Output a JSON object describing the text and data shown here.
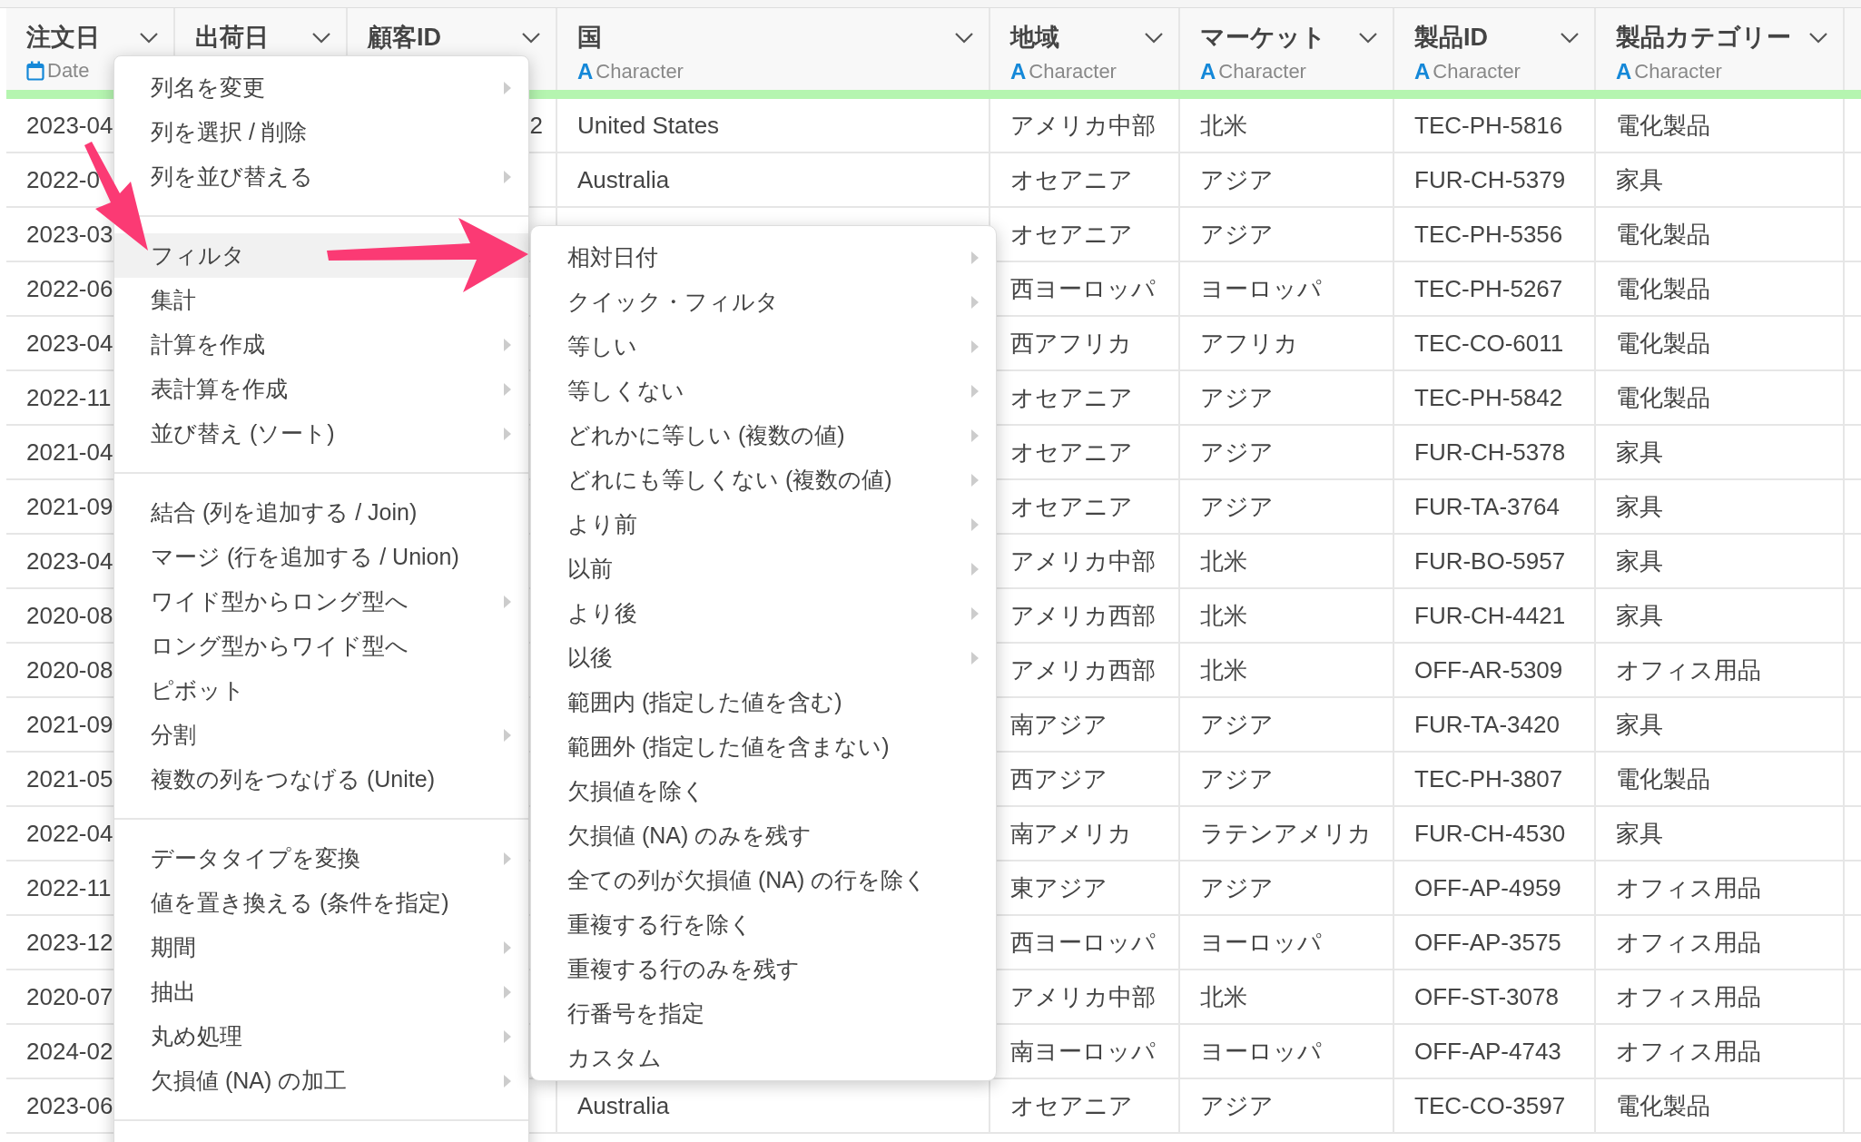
{
  "table": {
    "columns": [
      {
        "name": "注文日",
        "type": {
          "kind": "date",
          "label": "Date"
        }
      },
      {
        "name": "出荷日"
      },
      {
        "name": "顧客ID"
      },
      {
        "name": "国",
        "type": {
          "kind": "character",
          "glyph": "A",
          "label": "Character"
        }
      },
      {
        "name": "地域",
        "type": {
          "kind": "character",
          "glyph": "A",
          "label": "Character"
        }
      },
      {
        "name": "マーケット",
        "type": {
          "kind": "character",
          "glyph": "A",
          "label": "Character"
        }
      },
      {
        "name": "製品ID",
        "type": {
          "kind": "character",
          "glyph": "A",
          "label": "Character"
        }
      },
      {
        "name": "製品カテゴリー",
        "type": {
          "kind": "character",
          "glyph": "A",
          "label": "Character"
        }
      }
    ],
    "rows": [
      {
        "cells": [
          "2023-04",
          null,
          "2",
          "United States",
          "アメリカ中部",
          "北米",
          "TEC-PH-5816",
          "電化製品"
        ]
      },
      {
        "cells": [
          "2022-0",
          null,
          null,
          "Australia",
          "オセアニア",
          "アジア",
          "FUR-CH-5379",
          "家具"
        ]
      },
      {
        "cells": [
          "2023-03",
          null,
          null,
          null,
          "オセアニア",
          "アジア",
          "TEC-PH-5356",
          "電化製品"
        ]
      },
      {
        "cells": [
          "2022-06",
          null,
          null,
          null,
          "西ヨーロッパ",
          "ヨーロッパ",
          "TEC-PH-5267",
          "電化製品"
        ]
      },
      {
        "cells": [
          "2023-04",
          null,
          null,
          null,
          "西アフリカ",
          "アフリカ",
          "TEC-CO-6011",
          "電化製品"
        ]
      },
      {
        "cells": [
          "2022-11",
          null,
          null,
          null,
          "オセアニア",
          "アジア",
          "TEC-PH-5842",
          "電化製品"
        ]
      },
      {
        "cells": [
          "2021-04",
          null,
          null,
          null,
          "オセアニア",
          "アジア",
          "FUR-CH-5378",
          "家具"
        ]
      },
      {
        "cells": [
          "2021-09",
          null,
          null,
          null,
          "オセアニア",
          "アジア",
          "FUR-TA-3764",
          "家具"
        ]
      },
      {
        "cells": [
          "2023-04",
          null,
          null,
          null,
          "アメリカ中部",
          "北米",
          "FUR-BO-5957",
          "家具"
        ]
      },
      {
        "cells": [
          "2020-08",
          null,
          null,
          null,
          "アメリカ西部",
          "北米",
          "FUR-CH-4421",
          "家具"
        ]
      },
      {
        "cells": [
          "2020-08",
          null,
          null,
          null,
          "アメリカ西部",
          "北米",
          "OFF-AR-5309",
          "オフィス用品"
        ]
      },
      {
        "cells": [
          "2021-09",
          null,
          null,
          null,
          "南アジア",
          "アジア",
          "FUR-TA-3420",
          "家具"
        ]
      },
      {
        "cells": [
          "2021-05",
          null,
          null,
          null,
          "西アジア",
          "アジア",
          "TEC-PH-3807",
          "電化製品"
        ]
      },
      {
        "cells": [
          "2022-04",
          null,
          null,
          null,
          "南アメリカ",
          "ラテンアメリカ",
          "FUR-CH-4530",
          "家具"
        ]
      },
      {
        "cells": [
          "2022-11",
          null,
          null,
          null,
          "東アジア",
          "アジア",
          "OFF-AP-4959",
          "オフィス用品"
        ]
      },
      {
        "cells": [
          "2023-12",
          null,
          null,
          null,
          "西ヨーロッパ",
          "ヨーロッパ",
          "OFF-AP-3575",
          "オフィス用品"
        ]
      },
      {
        "cells": [
          "2020-07",
          null,
          null,
          null,
          "アメリカ中部",
          "北米",
          "OFF-ST-3078",
          "オフィス用品"
        ]
      },
      {
        "cells": [
          "2024-02",
          null,
          null,
          null,
          "南ヨーロッパ",
          "ヨーロッパ",
          "OFF-AP-4743",
          "オフィス用品"
        ]
      },
      {
        "cells": [
          "2023-06",
          null,
          null,
          "Australia",
          "オセアニア",
          "アジア",
          "TEC-CO-3597",
          "電化製品"
        ]
      }
    ]
  },
  "column_menu": {
    "sections": [
      [
        {
          "label": "列名を変更",
          "has_submenu": true,
          "selected": false
        },
        {
          "label": "列を選択 / 削除",
          "has_submenu": false,
          "selected": false
        },
        {
          "label": "列を並び替える",
          "has_submenu": true,
          "selected": false
        }
      ],
      [
        {
          "label": "フィルタ",
          "has_submenu": false,
          "selected": true
        },
        {
          "label": "集計",
          "has_submenu": false,
          "selected": false
        },
        {
          "label": "計算を作成",
          "has_submenu": true,
          "selected": false
        },
        {
          "label": "表計算を作成",
          "has_submenu": true,
          "selected": false
        },
        {
          "label": "並び替え (ソート)",
          "has_submenu": true,
          "selected": false
        }
      ],
      [
        {
          "label": "結合 (列を追加する / Join)",
          "has_submenu": false,
          "selected": false
        },
        {
          "label": "マージ (行を追加する / Union)",
          "has_submenu": false,
          "selected": false
        },
        {
          "label": "ワイド型からロング型へ",
          "has_submenu": true,
          "selected": false
        },
        {
          "label": "ロング型からワイド型へ",
          "has_submenu": false,
          "selected": false
        },
        {
          "label": "ピボット",
          "has_submenu": false,
          "selected": false
        },
        {
          "label": "分割",
          "has_submenu": true,
          "selected": false
        },
        {
          "label": "複数の列をつなげる (Unite)",
          "has_submenu": false,
          "selected": false
        }
      ],
      [
        {
          "label": "データタイプを変換",
          "has_submenu": true,
          "selected": false
        },
        {
          "label": "値を置き換える (条件を指定)",
          "has_submenu": false,
          "selected": false
        },
        {
          "label": "期間",
          "has_submenu": true,
          "selected": false
        },
        {
          "label": "抽出",
          "has_submenu": true,
          "selected": false
        },
        {
          "label": "丸め処理",
          "has_submenu": true,
          "selected": false
        },
        {
          "label": "欠損値 (NA) の加工",
          "has_submenu": true,
          "selected": false
        }
      ]
    ]
  },
  "filter_submenu": {
    "sections": [
      [
        {
          "label": "相対日付",
          "has_submenu": true,
          "selected": false
        },
        {
          "label": "クイック・フィルタ",
          "has_submenu": true,
          "selected": false
        },
        {
          "label": "等しい",
          "has_submenu": true,
          "selected": false
        },
        {
          "label": "等しくない",
          "has_submenu": true,
          "selected": false
        },
        {
          "label": "どれかに等しい (複数の値)",
          "has_submenu": true,
          "selected": false
        },
        {
          "label": "どれにも等しくない (複数の値)",
          "has_submenu": true,
          "selected": false
        },
        {
          "label": "より前",
          "has_submenu": true,
          "selected": false
        },
        {
          "label": "以前",
          "has_submenu": true,
          "selected": false
        },
        {
          "label": "より後",
          "has_submenu": true,
          "selected": false
        },
        {
          "label": "以後",
          "has_submenu": true,
          "selected": false
        },
        {
          "label": "範囲内 (指定した値を含む)",
          "has_submenu": false,
          "selected": false
        },
        {
          "label": "範囲外 (指定した値を含まない)",
          "has_submenu": false,
          "selected": false
        },
        {
          "label": "欠損値を除く",
          "has_submenu": false,
          "selected": false
        },
        {
          "label": "欠損値 (NA) のみを残す",
          "has_submenu": false,
          "selected": false
        },
        {
          "label": "全ての列が欠損値 (NA) の行を除く",
          "has_submenu": false,
          "selected": false
        },
        {
          "label": "重複する行を除く",
          "has_submenu": false,
          "selected": false
        },
        {
          "label": "重複する行のみを残す",
          "has_submenu": false,
          "selected": false
        },
        {
          "label": "行番号を指定",
          "has_submenu": false,
          "selected": false
        },
        {
          "label": "カスタム",
          "has_submenu": false,
          "selected": false
        }
      ]
    ]
  }
}
